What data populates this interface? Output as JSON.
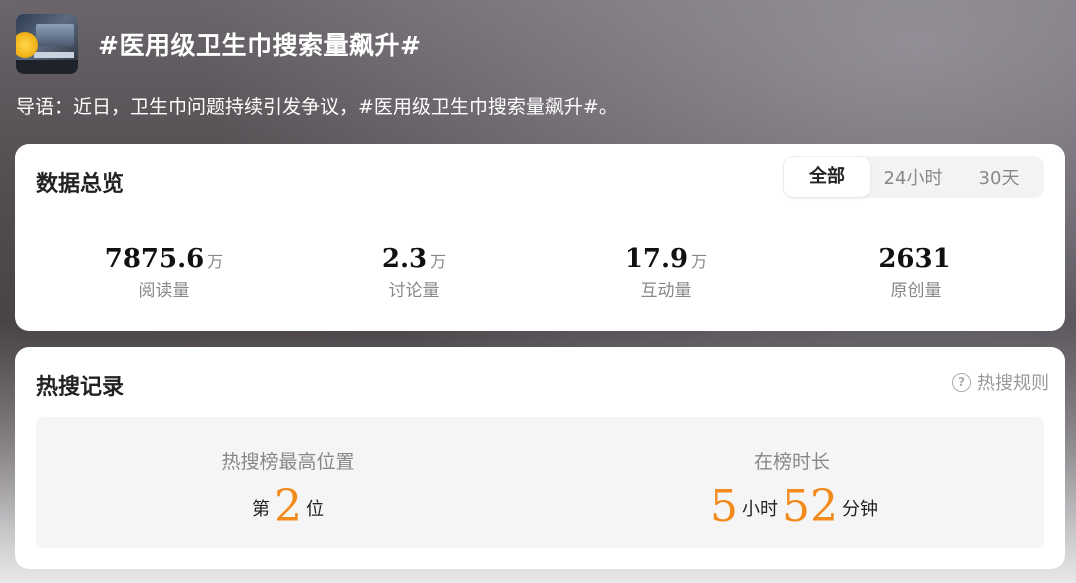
{
  "topic": {
    "title": "#医用级卫生巾搜索量飙升#",
    "intro": "导语：近日，卫生巾问题持续引发争议，#医用级卫生巾搜索量飙升#。"
  },
  "overview": {
    "title": "数据总览",
    "tabs": [
      "全部",
      "24小时",
      "30天"
    ],
    "active_tab": "全部",
    "stats": [
      {
        "value": "7875.6",
        "unit": "万",
        "label": "阅读量"
      },
      {
        "value": "2.3",
        "unit": "万",
        "label": "讨论量"
      },
      {
        "value": "17.9",
        "unit": "万",
        "label": "互动量"
      },
      {
        "value": "2631",
        "unit": "",
        "label": "原创量"
      }
    ]
  },
  "hot_search": {
    "title": "热搜记录",
    "rules_label": "热搜规则",
    "highest_position": {
      "label": "热搜榜最高位置",
      "prefix": "第",
      "value": "2",
      "suffix": "位"
    },
    "duration": {
      "label": "在榜时长",
      "hours": "5",
      "hours_unit": "小时",
      "minutes": "52",
      "minutes_unit": "分钟"
    }
  },
  "colors": {
    "accent": "#f28b1c",
    "card_bg": "#ffffff",
    "muted_text": "#888888"
  },
  "icons": {
    "rules": "question-circle-icon",
    "thumbnail": "topic-thumbnail-image"
  }
}
